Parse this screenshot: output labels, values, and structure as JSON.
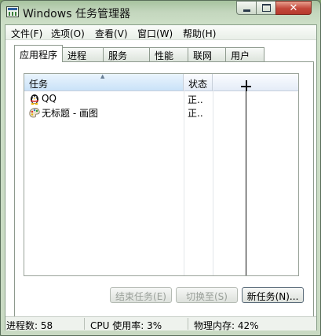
{
  "window": {
    "title": "Windows 任务管理器",
    "close_glyph": "✕"
  },
  "menu": [
    "文件(F)",
    "选项(O)",
    "查看(V)",
    "窗口(W)",
    "帮助(H)"
  ],
  "tabs": [
    "应用程序",
    "进程",
    "服务",
    "性能",
    "联网",
    "用户"
  ],
  "active_tab": "应用程序",
  "list": {
    "columns": {
      "task": "任务",
      "status": "状态"
    },
    "sort_glyph": "▲",
    "rows": [
      {
        "name": "QQ",
        "status": "正..",
        "icon": "qq-penguin-icon"
      },
      {
        "name": "无标题 - 画图",
        "status": "正..",
        "icon": "paint-icon"
      }
    ]
  },
  "buttons": {
    "end_task": "结束任务(E)",
    "switch_to": "切换至(S)",
    "new_task": "新任务(N)..."
  },
  "statusbar": {
    "processes": "进程数: 58",
    "cpu": "CPU 使用率: 3%",
    "memory": "物理内存: 42%"
  }
}
